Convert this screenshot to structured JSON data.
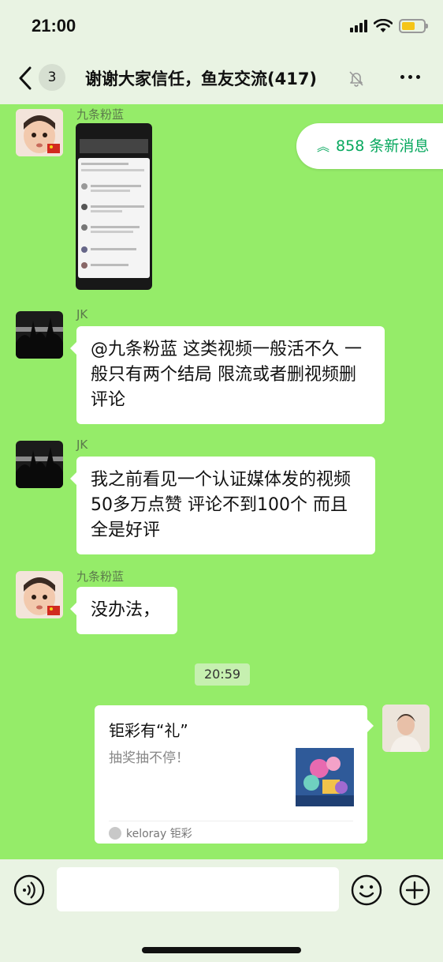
{
  "status_bar": {
    "time": "21:00"
  },
  "header": {
    "unread_count": "3",
    "title": "谢谢大家信任，鱼友交流(417)"
  },
  "new_messages": {
    "label": "858 条新消息"
  },
  "messages": [
    {
      "sender": "九条粉蓝",
      "type": "image"
    },
    {
      "sender": "JK",
      "text": "@九条粉蓝 这类视频一般活不久 一般只有两个结局 限流或者删视频删评论"
    },
    {
      "sender": "JK",
      "text": "我之前看见一个认证媒体发的视频50多万点赞 评论不到100个 而且全是好评"
    },
    {
      "sender": "九条粉蓝",
      "text": "没办法，"
    }
  ],
  "time_separator": "20:59",
  "share_card": {
    "title": "钜彩有“礼”",
    "desc": "抽奖抽不停！",
    "source": "keloray 钜彩"
  },
  "colors": {
    "chat_bg": "#95ec69",
    "bar_bg": "#e9f3e3",
    "accent": "#07a85e"
  },
  "icons": [
    "back-icon",
    "mute-icon",
    "more-icon",
    "voice-icon",
    "emoji-icon",
    "plus-icon",
    "signal-icon",
    "wifi-icon",
    "battery-icon"
  ]
}
